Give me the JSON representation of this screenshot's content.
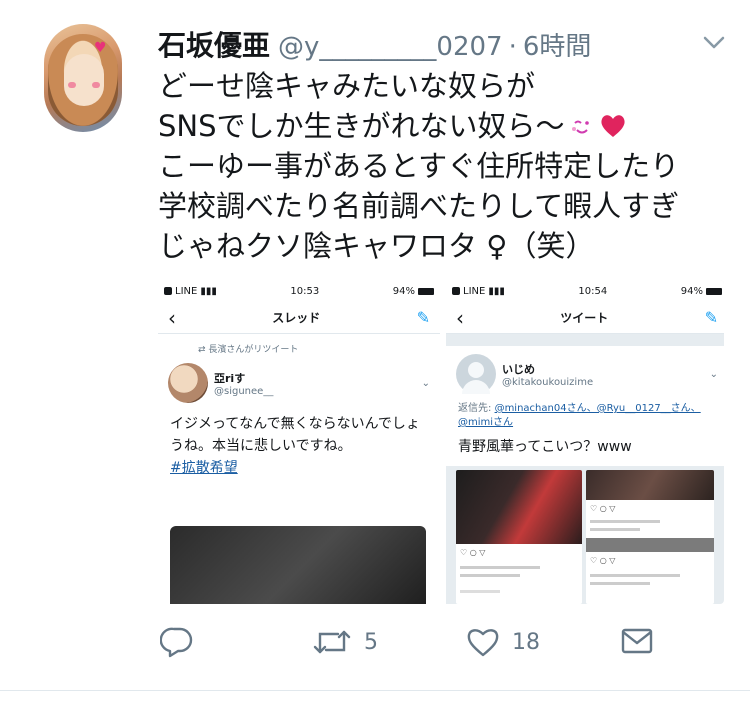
{
  "tweet": {
    "display_name": "石坂優亜",
    "handle": "@y_________0207",
    "separator": "·",
    "time": "6時間",
    "lines": [
      "どーせ陰キャみたいな奴らが",
      "SNSでしか生きがれない奴ら〜",
      "こーゆー事があるとすぐ住所特定したり",
      "学校調べたり名前調べたりして暇人すぎ",
      "じゃねクソ陰キャワロタ ♀（笑）"
    ],
    "emoji_after_line2": [
      "winking-face",
      "red-heart"
    ]
  },
  "screenshot_left": {
    "status": {
      "carrier": "LINE",
      "time": "10:53",
      "battery": "94%"
    },
    "nav_title": "スレッド",
    "retweet_label": "長濱さんがリツイート",
    "user_name": "亞riす",
    "user_handle": "@sigunee__",
    "text": "イジメってなんで無くならないんでしょうね。本当に悲しいですね。",
    "hashtag": "#拡散希望"
  },
  "screenshot_right": {
    "status": {
      "carrier": "LINE",
      "time": "10:54",
      "battery": "94%"
    },
    "nav_title": "ツイート",
    "user_name": "いじめ",
    "user_handle": "@kitakoukouizime",
    "reply_prefix": "返信先:",
    "reply_to": "@minachan04さん、@Ryu__0127__さん、@mimiさん",
    "text": "青野風華ってこいつ？www"
  },
  "actions": {
    "reply_count": "",
    "retweet_count": "5",
    "like_count": "18"
  },
  "colors": {
    "secondary_text": "#657786",
    "link": "#1b5ea3",
    "accent": "#1da1f2",
    "heart": "#e0245e"
  }
}
